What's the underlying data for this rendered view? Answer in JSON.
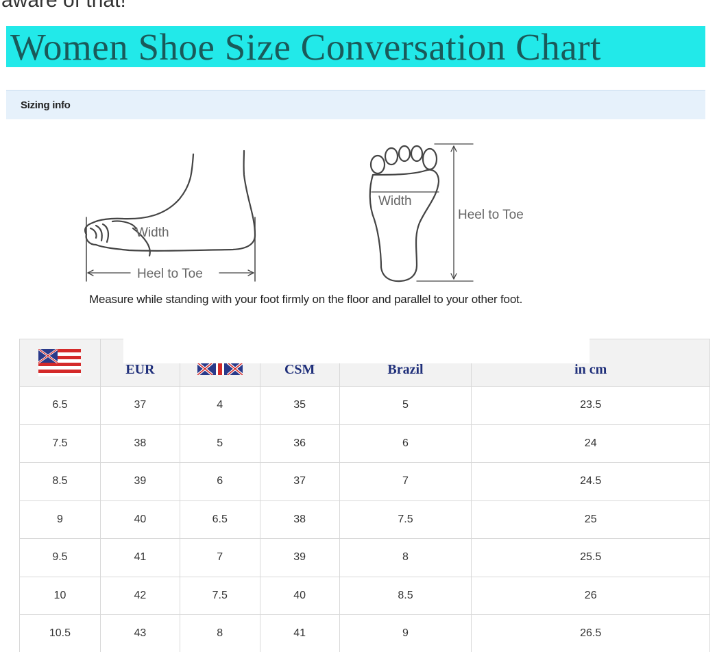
{
  "header_fragment": "aware of that!",
  "title": "Women Shoe Size Conversation Chart",
  "section_label": "Sizing info",
  "diagram": {
    "side_width_label": "Width",
    "side_length_label": "Heel to Toe",
    "sole_width_label": "Width",
    "sole_length_label": "Heel to Toe"
  },
  "measure_note": "Measure while standing with your foot firmly on the floor and parallel to your other foot.",
  "table": {
    "columns": [
      {
        "label": "",
        "icon": "us-flag-icon"
      },
      {
        "label": "EUR"
      },
      {
        "label": "",
        "icon": "uk-flag-icon"
      },
      {
        "label": "CSM"
      },
      {
        "label": "Brazil"
      },
      {
        "label": "in cm"
      }
    ],
    "rows": [
      [
        "6.5",
        "37",
        "4",
        "35",
        "5",
        "23.5"
      ],
      [
        "7.5",
        "38",
        "5",
        "36",
        "6",
        "24"
      ],
      [
        "8.5",
        "39",
        "6",
        "37",
        "7",
        "24.5"
      ],
      [
        "9",
        "40",
        "6.5",
        "38",
        "7.5",
        "25"
      ],
      [
        "9.5",
        "41",
        "7",
        "39",
        "8",
        "25.5"
      ],
      [
        "10",
        "42",
        "7.5",
        "40",
        "8.5",
        "26"
      ],
      [
        "10.5",
        "43",
        "8",
        "41",
        "9",
        "26.5"
      ]
    ]
  },
  "colors": {
    "banner": "#22e9e9",
    "title_text": "#1a5a5a",
    "section_bar": "#e6f1fb",
    "table_header_text": "#1f2f7a"
  }
}
